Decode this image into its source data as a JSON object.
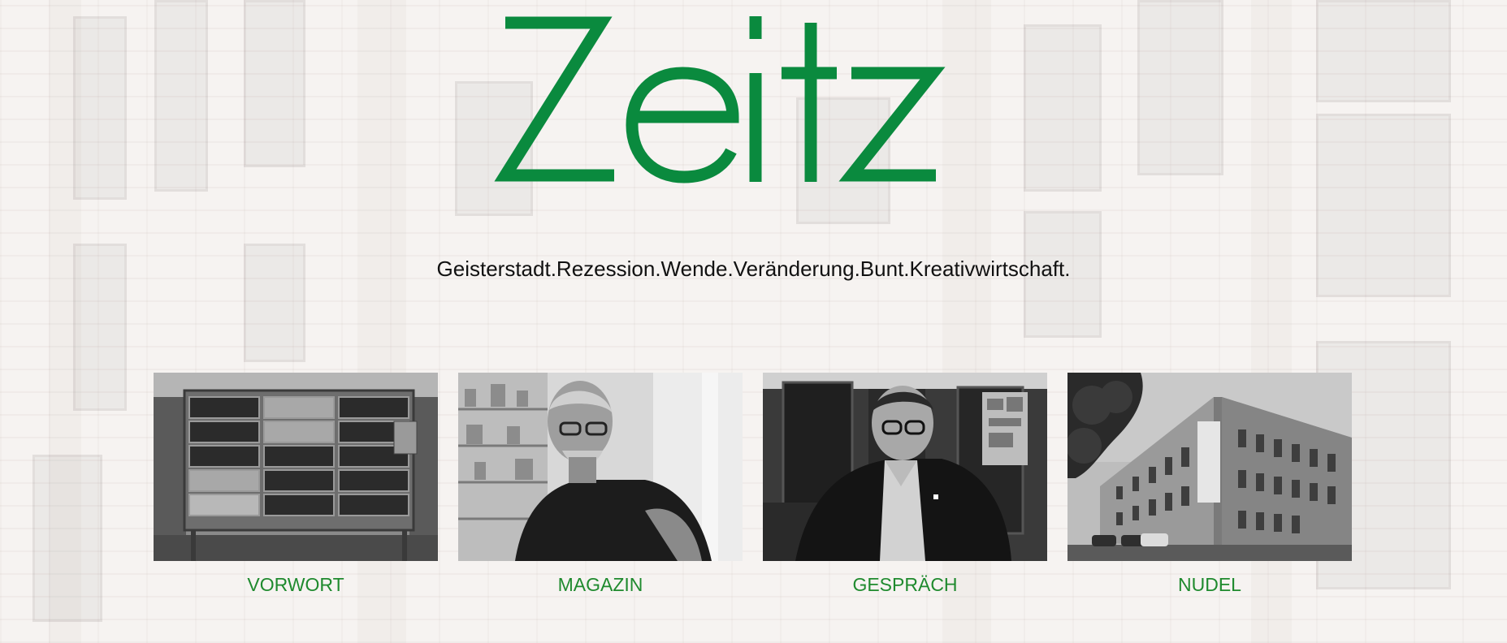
{
  "brand": {
    "logo_text": "Zeitz",
    "logo_color": "#0a8a3e"
  },
  "tagline": "Geisterstadt.Rezession.Wende.Veränderung.Bunt.Kreativwirtschaft.",
  "colors": {
    "label": "#1f8a2e",
    "tagline": "#111111",
    "background": "#f6f3f1"
  },
  "sections": [
    {
      "label": "VORWORT",
      "image": "mailboxes-photo"
    },
    {
      "label": "MAGAZIN",
      "image": "man-with-glasses-portrait-photo"
    },
    {
      "label": "GESPRÄCH",
      "image": "man-in-suit-portrait-photo"
    },
    {
      "label": "NUDEL",
      "image": "factory-building-photo"
    }
  ]
}
